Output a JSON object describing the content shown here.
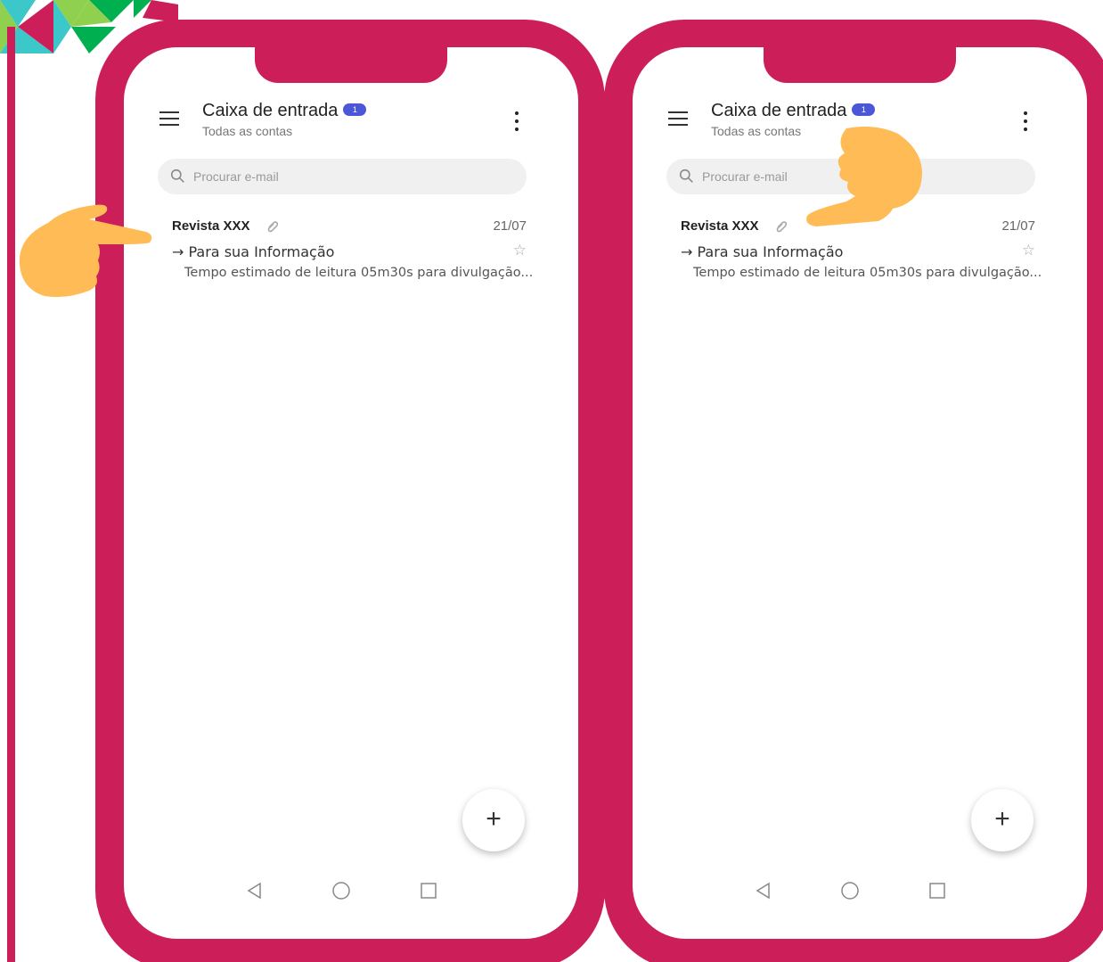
{
  "colors": {
    "frame": "#cc1f5a",
    "badge": "#4b57d6",
    "hand": "#ffbb55",
    "deco_teal": "#3cc8c8",
    "deco_green": "#00b050",
    "deco_lime": "#8fd14f"
  },
  "phones": [
    {
      "header": {
        "title": "Caixa de entrada",
        "badge": "1",
        "subtitle": "Todas as contas",
        "menu_icon": "hamburger-menu-icon",
        "more_icon": "kebab-menu-icon"
      },
      "search": {
        "placeholder": "Procurar e-mail",
        "icon": "search-icon"
      },
      "mail": {
        "sender": "Revista XXX",
        "date": "21/07",
        "subject": "→ Para sua Informação",
        "preview": "Tempo estimado de leitura 05m30s para divulgação...",
        "star": "☆",
        "attachment_icon": "paperclip-icon"
      },
      "fab": "+",
      "nav": [
        "back-icon",
        "home-icon",
        "recents-icon"
      ],
      "pointer": "pointing-hand-icon"
    },
    {
      "header": {
        "title": "Caixa de entrada",
        "badge": "1",
        "subtitle": "Todas as contas",
        "menu_icon": "hamburger-menu-icon",
        "more_icon": "kebab-menu-icon"
      },
      "search": {
        "placeholder": "Procurar e-mail",
        "icon": "search-icon"
      },
      "mail": {
        "sender": "Revista XXX",
        "date": "21/07",
        "subject": "→ Para sua Informação",
        "preview": "Tempo estimado de leitura 05m30s para divulgação...",
        "star": "☆",
        "attachment_icon": "paperclip-icon"
      },
      "fab": "+",
      "nav": [
        "back-icon",
        "home-icon",
        "recents-icon"
      ],
      "pointer": "pointing-hand-icon"
    }
  ]
}
